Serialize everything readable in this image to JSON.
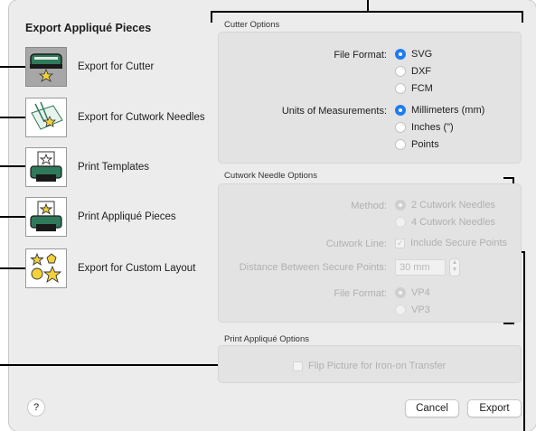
{
  "sidebar": {
    "title": "Export Appliqué Pieces",
    "items": [
      {
        "label": "Export for Cutter",
        "icon": "cutter-icon",
        "selected": true
      },
      {
        "label": "Export for Cutwork Needles",
        "icon": "cutwork-needles-icon",
        "selected": false
      },
      {
        "label": "Print Templates",
        "icon": "printer-template-icon",
        "selected": false
      },
      {
        "label": "Print Appliqué Pieces",
        "icon": "printer-applique-icon",
        "selected": false
      },
      {
        "label": "Export for Custom Layout",
        "icon": "shapes-icon",
        "selected": false
      }
    ]
  },
  "cutter_options": {
    "title": "Cutter Options",
    "file_format_label": "File Format:",
    "file_formats": [
      "SVG",
      "DXF",
      "FCM"
    ],
    "file_format_selected": "SVG",
    "units_label": "Units of Measurements:",
    "units": [
      "Millimeters (mm)",
      "Inches (\")",
      "Points"
    ],
    "units_selected": "Millimeters (mm)"
  },
  "cutwork_options": {
    "title": "Cutwork Needle Options",
    "method_label": "Method:",
    "methods": [
      "2 Cutwork Needles",
      "4 Cutwork Needles"
    ],
    "cutwork_line_label": "Cutwork Line:",
    "include_secure_points": "Include Secure Points",
    "distance_label": "Distance Between Secure Points:",
    "distance_value": "30 mm",
    "file_format_label": "File Format:",
    "file_formats": [
      "VP4",
      "VP3"
    ]
  },
  "print_options": {
    "title": "Print Appliqué Options",
    "flip_label": "Flip Picture for Iron-on Transfer"
  },
  "footer": {
    "help": "?",
    "cancel": "Cancel",
    "export": "Export"
  },
  "colors": {
    "accent": "#1f7cf0",
    "dialog_bg": "#ececec",
    "star": "#f2d13a"
  }
}
